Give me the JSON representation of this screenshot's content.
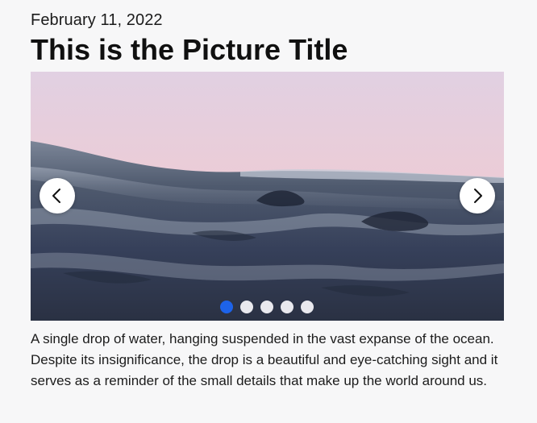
{
  "post": {
    "date": "February 11, 2022",
    "title": "This is the Picture Title",
    "caption": "A single drop of water, hanging suspended in the vast expanse of the ocean. Despite its insignificance, the drop is a beautiful and eye-catching sight and it serves as a reminder of the small details that make up the world around us."
  },
  "carousel": {
    "prev_icon": "chevron-left-icon",
    "next_icon": "chevron-right-icon",
    "slide_count": 5,
    "active_index": 0,
    "colors": {
      "active_dot": "#1d63ea",
      "inactive_dot": "#e9e9ee",
      "sky_top": "#e3cfe0",
      "sky_bottom": "#f1c9c8",
      "water_dark": "#2c3445"
    }
  }
}
